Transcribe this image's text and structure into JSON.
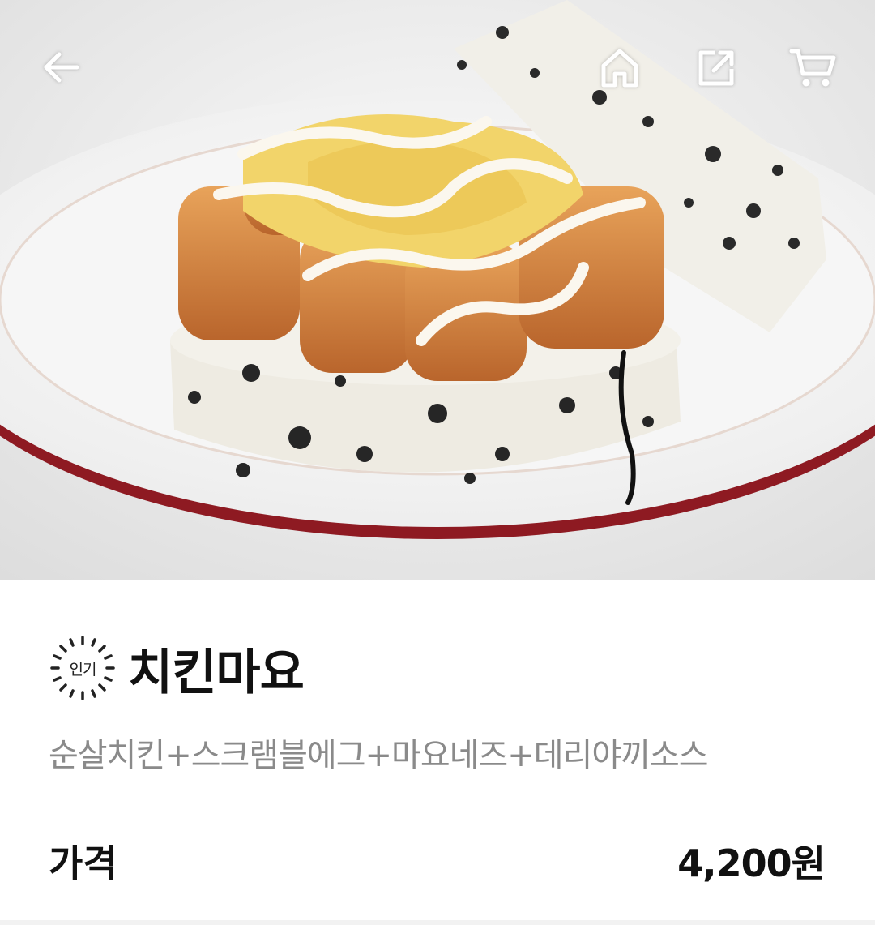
{
  "hero": {
    "image_alt": "",
    "topbar": {
      "back_icon": "arrow-left-icon",
      "home_icon": "home-icon",
      "share_icon": "share-icon",
      "cart_icon": "cart-icon",
      "icon_color": "#ffffff"
    }
  },
  "product": {
    "badge": "인기",
    "name": "치킨마요",
    "description": "순살치킨+스크램블에그+마요네즈+데리야끼소스",
    "price_label": "가격",
    "price": "4,200원"
  },
  "colors": {
    "plate_rim": "#8e1a22",
    "text_primary": "#111111",
    "text_secondary": "#8a8a8a"
  }
}
